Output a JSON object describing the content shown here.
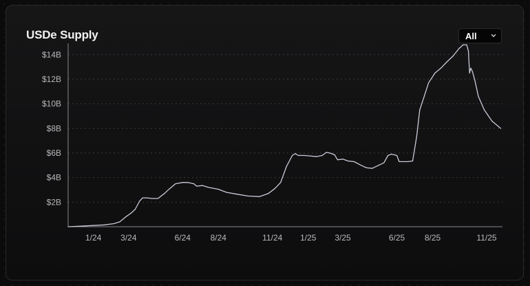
{
  "card": {
    "title": "USDe Supply",
    "range_select": {
      "selected": "All",
      "icon": "chevron-down-icon"
    }
  },
  "colors": {
    "line": "#c9ccd8",
    "grid": "#3a3a3d",
    "axis": "#8a8a90",
    "tick_text": "#b9b9bd"
  },
  "chart_data": {
    "type": "line",
    "title": "USDe Supply",
    "xlabel": "",
    "ylabel": "",
    "grid": "horizontal dashed",
    "legend": "none",
    "xlim": [
      "2023-11-19",
      "2025-11-28"
    ],
    "ylim": [
      0,
      14.8
    ],
    "y_unit": "B",
    "x_ticks": [
      {
        "label": "1/24",
        "date": "2024-01-01"
      },
      {
        "label": "3/24",
        "date": "2024-03-01"
      },
      {
        "label": "6/24",
        "date": "2024-06-01"
      },
      {
        "label": "8/24",
        "date": "2024-08-01"
      },
      {
        "label": "11/24",
        "date": "2024-11-01"
      },
      {
        "label": "1/25",
        "date": "2025-01-01"
      },
      {
        "label": "3/25",
        "date": "2025-03-01"
      },
      {
        "label": "6/25",
        "date": "2025-06-01"
      },
      {
        "label": "8/25",
        "date": "2025-08-01"
      },
      {
        "label": "11/25",
        "date": "2025-11-01"
      }
    ],
    "y_ticks": [
      {
        "label": "$2B",
        "value": 2
      },
      {
        "label": "$4B",
        "value": 4
      },
      {
        "label": "$6B",
        "value": 6
      },
      {
        "label": "$8B",
        "value": 8
      },
      {
        "label": "$10B",
        "value": 10
      },
      {
        "label": "$12B",
        "value": 12
      },
      {
        "label": "$14B",
        "value": 14
      }
    ],
    "series": [
      {
        "x": [
          "2023-11-19",
          "2023-12-10",
          "2024-01-01",
          "2024-01-20",
          "2024-02-05",
          "2024-02-15",
          "2024-02-25",
          "2024-03-05",
          "2024-03-12",
          "2024-03-20",
          "2024-03-25",
          "2024-04-01",
          "2024-04-10",
          "2024-04-20",
          "2024-05-01",
          "2024-05-10",
          "2024-05-20",
          "2024-06-01",
          "2024-06-10",
          "2024-06-20",
          "2024-06-25",
          "2024-07-05",
          "2024-07-15",
          "2024-08-01",
          "2024-08-15",
          "2024-09-01",
          "2024-09-20",
          "2024-10-10",
          "2024-10-25",
          "2024-11-05",
          "2024-11-15",
          "2024-11-25",
          "2024-12-05",
          "2024-12-10",
          "2024-12-15",
          "2024-12-25",
          "2025-01-05",
          "2025-01-15",
          "2025-01-25",
          "2025-02-01",
          "2025-02-07",
          "2025-02-15",
          "2025-02-20",
          "2025-03-01",
          "2025-03-10",
          "2025-03-20",
          "2025-04-01",
          "2025-04-10",
          "2025-04-20",
          "2025-05-01",
          "2025-05-10",
          "2025-05-17",
          "2025-05-23",
          "2025-06-01",
          "2025-06-05",
          "2025-06-10",
          "2025-06-20",
          "2025-06-28",
          "2025-07-02",
          "2025-07-05",
          "2025-07-10",
          "2025-07-17",
          "2025-07-25",
          "2025-08-05",
          "2025-08-15",
          "2025-08-25",
          "2025-09-05",
          "2025-09-15",
          "2025-09-22",
          "2025-09-28",
          "2025-10-01",
          "2025-10-03",
          "2025-10-05",
          "2025-10-08",
          "2025-10-12",
          "2025-10-18",
          "2025-10-28",
          "2025-11-10",
          "2025-11-25"
        ],
        "values": [
          0.0,
          0.05,
          0.1,
          0.15,
          0.25,
          0.4,
          0.8,
          1.1,
          1.4,
          2.1,
          2.35,
          2.35,
          2.3,
          2.3,
          2.7,
          3.1,
          3.5,
          3.6,
          3.6,
          3.5,
          3.3,
          3.35,
          3.2,
          3.05,
          2.8,
          2.65,
          2.5,
          2.45,
          2.7,
          3.1,
          3.6,
          4.9,
          5.8,
          5.95,
          5.8,
          5.8,
          5.75,
          5.7,
          5.8,
          6.05,
          6.0,
          5.85,
          5.45,
          5.5,
          5.35,
          5.3,
          5.0,
          4.8,
          4.75,
          5.0,
          5.2,
          5.8,
          5.9,
          5.8,
          5.3,
          5.3,
          5.3,
          5.35,
          6.5,
          7.4,
          9.5,
          10.5,
          11.7,
          12.5,
          12.9,
          13.4,
          13.9,
          14.5,
          14.8,
          14.8,
          14.3,
          12.5,
          12.9,
          12.6,
          11.9,
          10.6,
          9.5,
          8.6,
          8.0
        ]
      }
    ]
  }
}
